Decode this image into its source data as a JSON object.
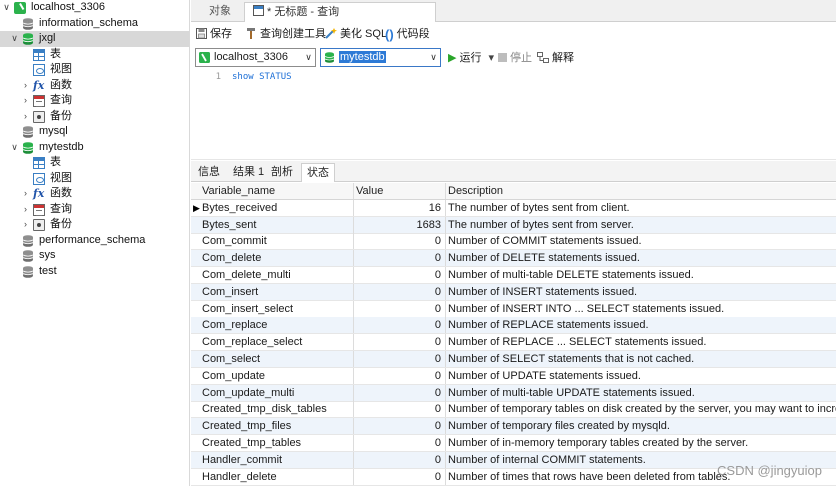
{
  "tree": [
    {
      "label": "localhost_3306",
      "level": 0,
      "icon": "connection-icon",
      "expand": "∨",
      "selected": false
    },
    {
      "label": "information_schema",
      "level": 1,
      "icon": "database-icon",
      "expand": "",
      "selected": false
    },
    {
      "label": "jxgl",
      "level": 1,
      "icon": "database-icon",
      "expand": "∨",
      "selected": true,
      "active": true
    },
    {
      "label": "表",
      "level": 2,
      "icon": "table-icon",
      "expand": "",
      "selected": false
    },
    {
      "label": "视图",
      "level": 2,
      "icon": "view-icon",
      "expand": "",
      "selected": false
    },
    {
      "label": "函数",
      "level": 2,
      "icon": "function-icon",
      "expand": "›",
      "selected": false
    },
    {
      "label": "查询",
      "level": 2,
      "icon": "query-icon",
      "expand": "›",
      "selected": false
    },
    {
      "label": "备份",
      "level": 2,
      "icon": "backup-icon",
      "expand": "›",
      "selected": false
    },
    {
      "label": "mysql",
      "level": 1,
      "icon": "database-icon",
      "expand": "",
      "selected": false
    },
    {
      "label": "mytestdb",
      "level": 1,
      "icon": "database-icon",
      "expand": "∨",
      "selected": false,
      "active": true
    },
    {
      "label": "表",
      "level": 2,
      "icon": "table-icon",
      "expand": "",
      "selected": false
    },
    {
      "label": "视图",
      "level": 2,
      "icon": "view-icon",
      "expand": "",
      "selected": false
    },
    {
      "label": "函数",
      "level": 2,
      "icon": "function-icon",
      "expand": "›",
      "selected": false
    },
    {
      "label": "查询",
      "level": 2,
      "icon": "query-icon",
      "expand": "›",
      "selected": false
    },
    {
      "label": "备份",
      "level": 2,
      "icon": "backup-icon",
      "expand": "›",
      "selected": false
    },
    {
      "label": "performance_schema",
      "level": 1,
      "icon": "database-icon",
      "expand": "",
      "selected": false
    },
    {
      "label": "sys",
      "level": 1,
      "icon": "database-icon",
      "expand": "",
      "selected": false
    },
    {
      "label": "test",
      "level": 1,
      "icon": "database-icon",
      "expand": "",
      "selected": false
    }
  ],
  "tabs": {
    "objects": "对象",
    "query_tab": "* 无标题 - 查询"
  },
  "toolbar": {
    "save": "保存",
    "query_builder": "查询创建工具",
    "beautify": "美化 SQL",
    "snippet": "代码段"
  },
  "selectors": {
    "connection": "localhost_3306",
    "database": "mytestdb",
    "run": "运行",
    "run_menu": "▾",
    "stop": "停止",
    "explain": "解释"
  },
  "editor": {
    "line_number": "1",
    "code": "show STATUS"
  },
  "result_tabs": [
    "信息",
    "结果 1",
    "剖析",
    "状态"
  ],
  "grid": {
    "headers": [
      "Variable_name",
      "Value",
      "Description"
    ],
    "current_row_marker": "▶",
    "rows": [
      [
        "Bytes_received",
        "16",
        "The number of bytes sent from client."
      ],
      [
        "Bytes_sent",
        "1683",
        "The number of bytes sent from server."
      ],
      [
        "Com_commit",
        "0",
        "Number of COMMIT statements issued."
      ],
      [
        "Com_delete",
        "0",
        "Number of DELETE statements issued."
      ],
      [
        "Com_delete_multi",
        "0",
        "Number of multi-table DELETE statements issued."
      ],
      [
        "Com_insert",
        "0",
        "Number of INSERT statements issued."
      ],
      [
        "Com_insert_select",
        "0",
        "Number of INSERT INTO ... SELECT statements issued."
      ],
      [
        "Com_replace",
        "0",
        "Number of REPLACE statements issued."
      ],
      [
        "Com_replace_select",
        "0",
        "Number of REPLACE ... SELECT statements issued."
      ],
      [
        "Com_select",
        "0",
        "Number of SELECT statements that is not cached."
      ],
      [
        "Com_update",
        "0",
        "Number of UPDATE statements issued."
      ],
      [
        "Com_update_multi",
        "0",
        "Number of multi-table UPDATE statements issued."
      ],
      [
        "Created_tmp_disk_tables",
        "0",
        "Number of temporary tables on disk created by the server, you may want to increase"
      ],
      [
        "Created_tmp_files",
        "0",
        "Number of temporary files created by mysqld."
      ],
      [
        "Created_tmp_tables",
        "0",
        "Number of in-memory temporary tables created by the server."
      ],
      [
        "Handler_commit",
        "0",
        "Number of internal COMMIT statements."
      ],
      [
        "Handler_delete",
        "0",
        "Number of times that rows have been deleted from tables."
      ]
    ]
  },
  "watermark": "CSDN @jingyuiop",
  "colors": {
    "accent": "#2d7ad6",
    "connection": "#2bb24c",
    "sql_text": "#1d6fd6",
    "run": "#2aa52a",
    "row_alt": "#eef4fb"
  }
}
